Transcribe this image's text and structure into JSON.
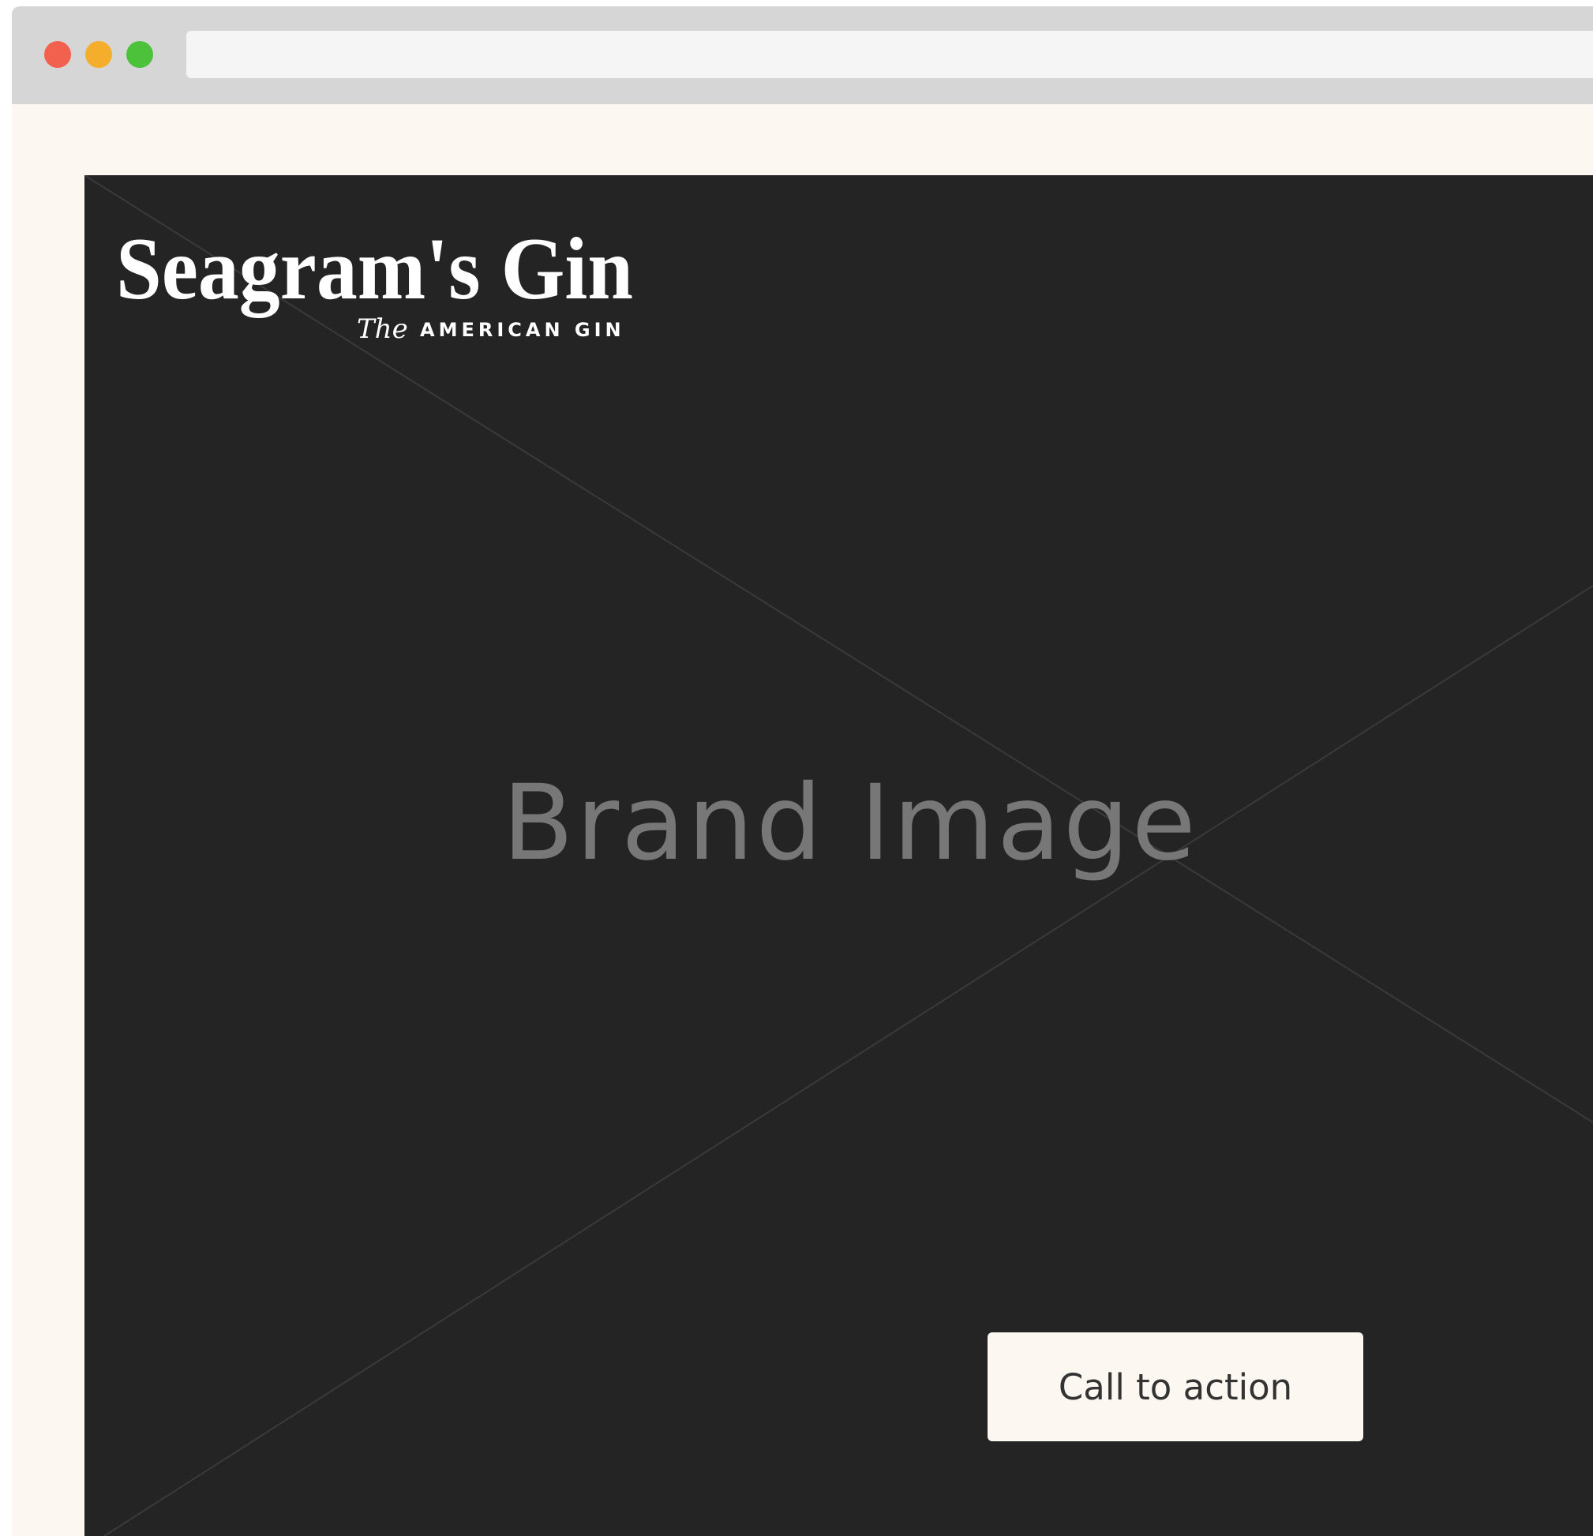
{
  "browser": {
    "controls": {
      "close_color": "#f2604e",
      "minimize_color": "#f5ae2c",
      "maximize_color": "#4bc23a"
    },
    "address_bar": {
      "value": ""
    }
  },
  "hero": {
    "logo": {
      "wordmark": "Seagram's Gin",
      "tagline_prefix": "The",
      "tagline": "AMERICAN GIN"
    },
    "image_placeholder_label": "Brand Image",
    "cta_label": "Call to action"
  },
  "colors": {
    "page_background": "#fdf7f1",
    "hero_background": "#242424",
    "placeholder_text": "#777777",
    "cta_background": "#fdf7f1",
    "cta_text": "#333333"
  }
}
